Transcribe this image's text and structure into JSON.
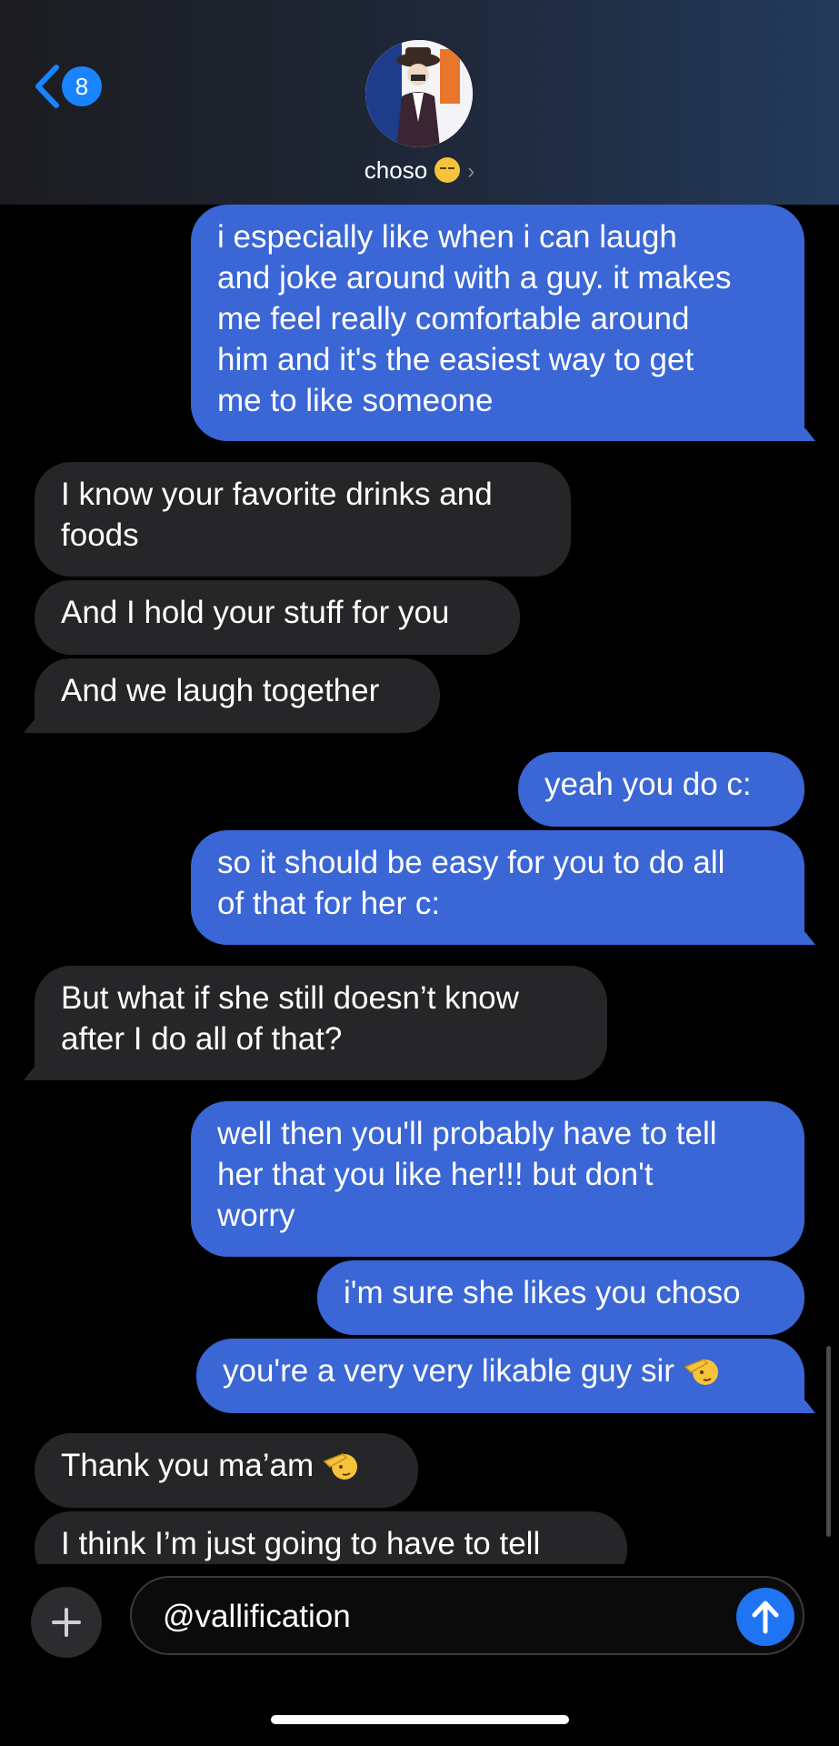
{
  "header": {
    "unread_count": "8",
    "contact_name": "choso"
  },
  "messages": [
    {
      "id": "m1",
      "side": "sent",
      "lines": [
        "i especially like when i can laugh",
        "and joke around with a guy. it makes",
        "me feel really comfortable around",
        "him and it's the easiest way to get",
        "me to like someone"
      ]
    },
    {
      "id": "m2",
      "side": "received",
      "lines": [
        "I know your favorite drinks and",
        "foods"
      ]
    },
    {
      "id": "m3",
      "side": "received",
      "lines": [
        "And I hold your stuff for you"
      ]
    },
    {
      "id": "m4",
      "side": "received",
      "lines": [
        "And we laugh together"
      ]
    },
    {
      "id": "m5",
      "side": "sent",
      "lines": [
        "yeah you do c:"
      ]
    },
    {
      "id": "m6",
      "side": "sent",
      "lines": [
        "so it should be easy for you to do all",
        "of that for her c:"
      ]
    },
    {
      "id": "m7",
      "side": "received",
      "lines": [
        "But what if she still doesn’t know",
        "after I do all of that?"
      ]
    },
    {
      "id": "m8",
      "side": "sent",
      "lines": [
        "well then you'll probably have to tell",
        "her that you like her!!! but don't",
        "worry"
      ]
    },
    {
      "id": "m9",
      "side": "sent",
      "lines": [
        "i'm sure she likes you choso"
      ]
    },
    {
      "id": "m10",
      "side": "sent",
      "lines": [
        "you're a very very likable guy sir"
      ]
    },
    {
      "id": "m11",
      "side": "received",
      "lines": [
        "Thank you ma’am"
      ]
    },
    {
      "id": "m12",
      "side": "received",
      "lines": [
        "I think I’m just going to have to tell"
      ]
    }
  ],
  "composer": {
    "input_value": "@vallification"
  },
  "icons": {
    "back": "chevron-left-icon",
    "add": "plus-icon",
    "send": "arrow-up-icon",
    "salute_emoji": "saluting-face-emoji"
  },
  "colors": {
    "sent_bubble": "#3a66d6",
    "received_bubble": "#262629",
    "accent": "#1a84ff"
  }
}
